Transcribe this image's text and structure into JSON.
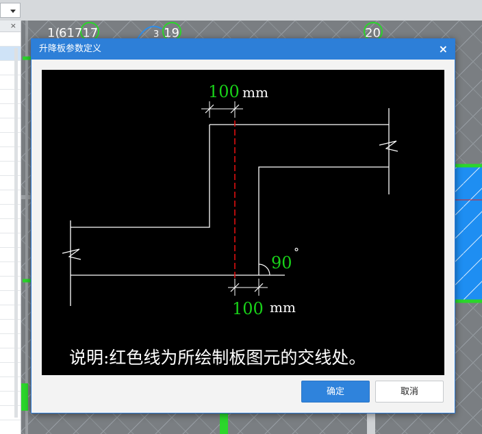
{
  "dialog": {
    "title": "升降板参数定义",
    "close_symbol": "×",
    "ok_label": "确定",
    "cancel_label": "取消"
  },
  "diagram": {
    "top_width_value": "100",
    "top_width_unit": "mm",
    "bottom_width_value": "100",
    "bottom_width_unit": "mm",
    "angle_value": "90",
    "angle_unit": "°",
    "note": "说明:红色线为所绘制板图元的交线处。"
  },
  "background": {
    "close_symbol": "×",
    "axis_labels": [
      "1(",
      "61717",
      "3",
      "19",
      "20"
    ]
  },
  "colors": {
    "dialog_title_bg": "#2d7fd8",
    "dimension_green": "#19d219",
    "intersection_red": "#e01010",
    "drawing_white": "#ffffff"
  }
}
